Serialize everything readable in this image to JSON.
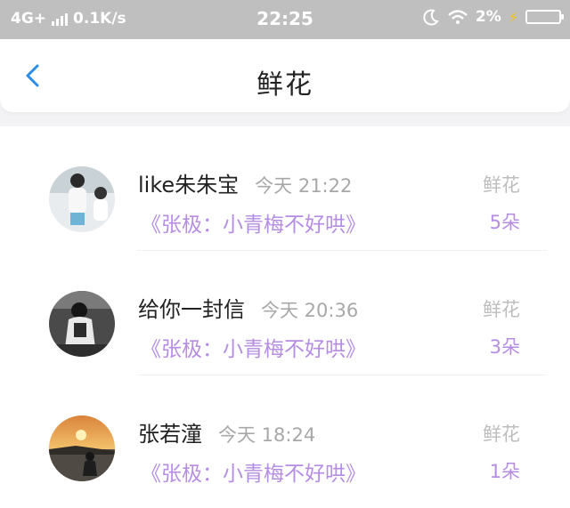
{
  "status_bar": {
    "network": "4G+",
    "speed": "0.1K/s",
    "time": "22:25",
    "battery_percent": "2%",
    "icons": [
      "signal-icon",
      "moon-icon",
      "wifi-icon",
      "charging-icon",
      "battery-icon"
    ]
  },
  "header": {
    "title": "鲜花",
    "back_icon": "chevron-left-icon",
    "accent_color": "#2b8de8"
  },
  "colors": {
    "book_text": "#b58ee3",
    "gift_label": "#bdbdbd"
  },
  "gifts": [
    {
      "user": "like朱朱宝",
      "time": "今天 21:22",
      "book": "《张极：小青梅不好哄》",
      "gift_label": "鲜花",
      "gift_count": "5朵"
    },
    {
      "user": "给你一封信",
      "time": "今天 20:36",
      "book": "《张极：小青梅不好哄》",
      "gift_label": "鲜花",
      "gift_count": "3朵"
    },
    {
      "user": "张若潼",
      "time": "今天 18:24",
      "book": "《张极：小青梅不好哄》",
      "gift_label": "鲜花",
      "gift_count": "1朵"
    }
  ]
}
